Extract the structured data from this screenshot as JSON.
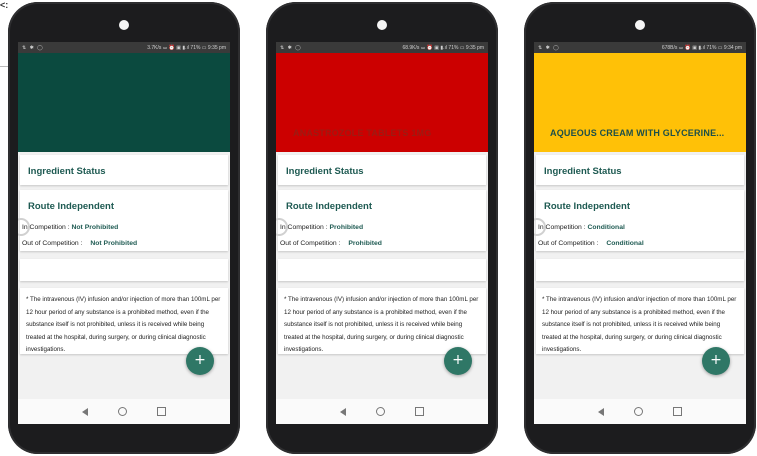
{
  "corner_text": "<:",
  "phones": [
    {
      "status": {
        "left": "⇅ ✱ ◯",
        "right": "3.7K/s ⚍ ⏰ ▣ ▮.ıl 71% ▭ 9:35 pm"
      },
      "header_color": "#0b4a3f",
      "drug_name": "",
      "ingredient_status_label": "Ingredient Status",
      "route_label": "Route Independent",
      "in_competition_label": "In Competition :",
      "in_competition_value": "Not Prohibited",
      "out_competition_label": "Out of Competition :",
      "out_competition_value": "Not Prohibited",
      "note": "* The intravenous (IV) infusion and/or injection of more than 100mL per 12 hour period of any substance is a prohibited method, even if the substance itself is not prohibited, unless it is received while being treated at the hospital, during surgery, or during clinical diagnostic investigations.",
      "fab": "+"
    },
    {
      "status": {
        "left": "⇅ ✱ ◯",
        "right": "68.9K/s ⚍ ⏰ ▣ ▮.ıl 71% ▭ 9:35 pm"
      },
      "header_color": "#cc0000",
      "drug_name": "ANASTROZOLE TABLETS 1MG",
      "ingredient_status_label": "Ingredient Status",
      "route_label": "Route Independent",
      "in_competition_label": "In Competition :",
      "in_competition_value": "Prohibited",
      "out_competition_label": "Out of Competition :",
      "out_competition_value": "Prohibited",
      "note": "* The intravenous (IV) infusion and/or injection of more than 100mL per 12 hour period of any substance is a prohibited method, even if the substance itself is not prohibited, unless it is received while being treated at the hospital, during surgery, or during clinical diagnostic investigations.",
      "fab": "+"
    },
    {
      "status": {
        "left": "⇅ ✱ ◯",
        "right": "678B/s ⚍ ⏰ ▣ ▮.ıl 71% ▭ 9:34 pm"
      },
      "header_color": "#ffc107",
      "drug_name": "AQUEOUS CREAM WITH GLYCERINE...",
      "ingredient_status_label": "Ingredient Status",
      "route_label": "Route Independent",
      "in_competition_label": "In Competition :",
      "in_competition_value": "Conditional",
      "out_competition_label": "Out of Competition :",
      "out_competition_value": "Conditional",
      "note": "* The intravenous (IV) infusion and/or injection of more than 100mL per 12 hour period of any substance is a prohibited method, even if the substance itself is not prohibited, unless it is received while being treated at the hospital, during surgery, or during clinical diagnostic investigations.",
      "fab": "+"
    }
  ]
}
